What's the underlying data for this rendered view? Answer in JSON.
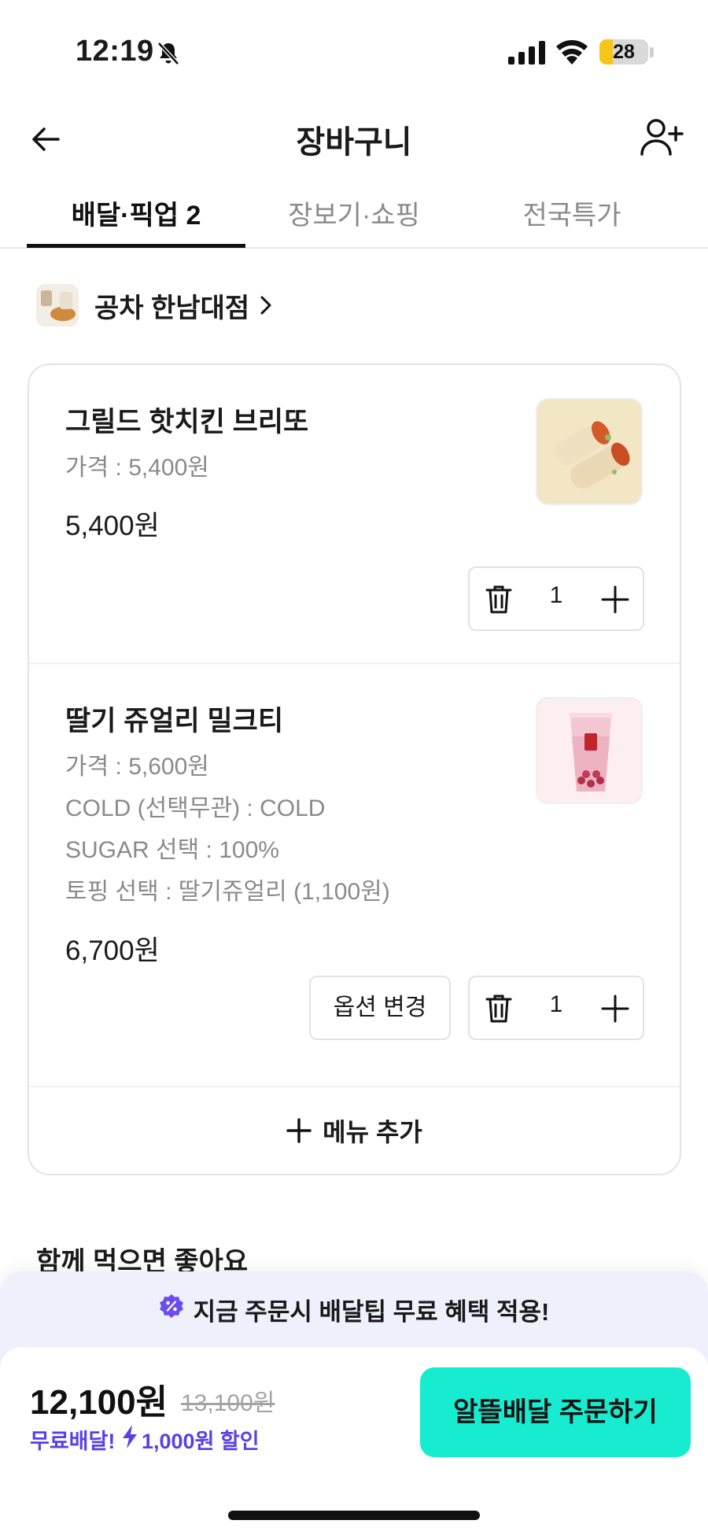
{
  "status_bar": {
    "time": "12:19",
    "battery_percent": 28,
    "battery_text": "28",
    "icons": [
      "bell-slash-icon",
      "signal-icon",
      "wifi-icon",
      "battery-icon"
    ]
  },
  "header": {
    "title": "장바구니",
    "back_icon": "arrow-left-icon",
    "share_icon": "add-user-icon"
  },
  "tabs": [
    {
      "label": "배달·픽업 2",
      "active": true
    },
    {
      "label": "장보기·쇼핑",
      "active": false
    },
    {
      "label": "전국특가",
      "active": false
    }
  ],
  "store": {
    "name": "공차 한남대점"
  },
  "items": [
    {
      "name": "그릴드 핫치킨 브리또",
      "options": [
        "가격 : 5,400원"
      ],
      "total": "5,400원",
      "quantity": "1"
    },
    {
      "name": "딸기 쥬얼리 밀크티",
      "options": [
        "가격 : 5,600원",
        "COLD (선택무관) : COLD",
        "SUGAR 선택 : 100%",
        "토핑 선택 : 딸기쥬얼리 (1,100원)"
      ],
      "total": "6,700원",
      "quantity": "1",
      "option_change_label": "옵션 변경"
    }
  ],
  "add_menu_label": "메뉴 추가",
  "section_title": "함께 먹으면 좋아요",
  "benefit_banner": "지금 주문시 배달팁 무료 혜택 적용!",
  "order": {
    "price": "12,100원",
    "original_price": "13,100원",
    "free_delivery": "무료배달!",
    "discount": "1,000원 할인",
    "button_label": "알뜰배달 주문하기"
  },
  "colors": {
    "accent_mint": "#17ecd0",
    "discount_purple": "#5b3ee6",
    "banner_bg": "#eef0fb",
    "battery_yellow": "#f7c51a"
  }
}
